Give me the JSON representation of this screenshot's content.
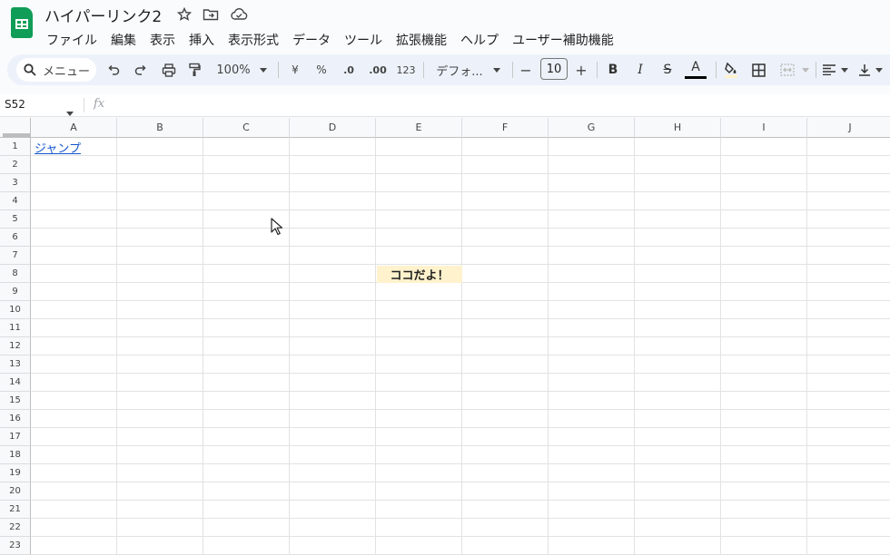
{
  "app": {
    "title": "ハイパーリンク2",
    "icons": [
      "star-icon",
      "move-folder-icon",
      "cloud-status-icon"
    ]
  },
  "menu": [
    "ファイル",
    "編集",
    "表示",
    "挿入",
    "表示形式",
    "データ",
    "ツール",
    "拡張機能",
    "ヘルプ",
    "ユーザー補助機能"
  ],
  "toolbar": {
    "search_label": "メニュー",
    "zoom": "100%",
    "currency": "¥",
    "percent": "%",
    "decimal_decrease": ".0",
    "decimal_increase": ".00",
    "number_format": "123",
    "font": "デフォ...",
    "font_size": "10",
    "minus": "−",
    "plus": "+",
    "bold": "B",
    "italic": "I",
    "strike": "S",
    "text_color": "A"
  },
  "formula_bar": {
    "name_box": "S52",
    "fx": "fx"
  },
  "sheet": {
    "columns": [
      "A",
      "B",
      "C",
      "D",
      "E",
      "F",
      "G",
      "H",
      "I",
      "J"
    ],
    "rows": [
      "1",
      "2",
      "3",
      "4",
      "5",
      "6",
      "7",
      "8",
      "9",
      "10",
      "11",
      "12",
      "13",
      "14",
      "15",
      "16",
      "17",
      "18",
      "19",
      "20",
      "21",
      "22",
      "23"
    ],
    "cells": {
      "A1": "ジャンプ",
      "E8": "ココだよ！"
    },
    "colors": {
      "link": "#1155cc",
      "highlight_fill": "#fff2cc",
      "logo": "#0f9d58"
    }
  }
}
